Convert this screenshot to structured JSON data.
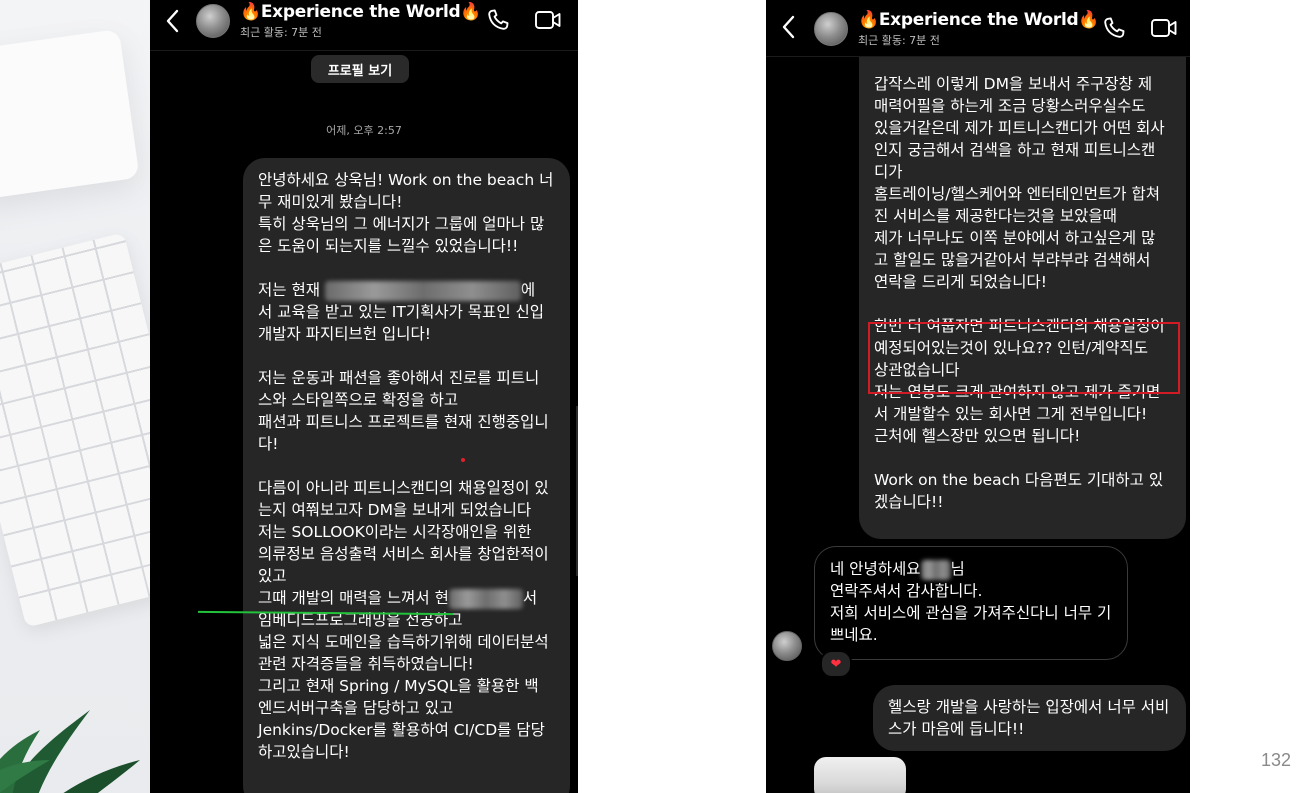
{
  "page": {
    "page_number": "132"
  },
  "left_chat": {
    "header": {
      "title": "🔥Experience the World🔥",
      "subtitle": "최근 활동: 7분 전"
    },
    "profile_button_label": "프로필 보기",
    "timestamp": "어제, 오후 2:57",
    "message": {
      "lines": [
        "안녕하세요 상욱님! Work on the beach 너",
        "무 재미있게 봤습니다!",
        "특히 상욱님의 그 에너지가 그룹에 얼마나 많",
        "은 도움이 되는지를 느낄수 있었습니다!!",
        "",
        "저는 현재",
        "에",
        "서 교육을 받고 있는 IT기획사가 목표인 신입",
        "개발자 파지티브헌 입니다!",
        "",
        "저는 운동과 패션을 좋아해서 진로를 피트니",
        "스와 스타일쪽으로 확정을 하고",
        "패션과 피트니스 프로젝트를 현재 진행중입니",
        "다!",
        "",
        "다름이 아니라 피트니스캔디의 채용일정이 있",
        "는지 여쭤보고자 DM을 보내게 되었습니다",
        "저는 SOLLOOK이라는 시각장애인을 위한",
        "의류정보 음성출력 서비스 회사를 창업한적이",
        "있고",
        "그때 개발의 매력을 느껴서 현",
        "서",
        "임베디드프로그래밍을 전공하고",
        "넓은 지식 도메인을 습득하기위해 데이터분석",
        "관련 자격증들을 취득하였습니다!",
        "그리고 현재 Spring /  MySQL을 활용한 백",
        "엔드서버구축을 담당하고 있고",
        "Jenkins/Docker를 활용하여 CI/CD를 담당",
        "하고있습니다!"
      ]
    }
  },
  "right_chat": {
    "header": {
      "title": "🔥Experience the World🔥",
      "subtitle": "최근 활동: 7분 전"
    },
    "outgoing_1": {
      "lines": [
        "갑작스레 이렇게 DM을 보내서 주구장창 제",
        "매력어필을 하는게 조금 당황스러우실수도",
        "있을거같은데 제가 피트니스캔디가 어떤 회사",
        "인지 궁금해서 검색을 하고 현재 피트니스캔",
        "디가",
        "홈트레이닝/헬스케어와 엔터테인먼트가 합쳐",
        "진 서비스를 제공한다는것을 보았을때",
        "제가 너무나도 이쪽 분야에서 하고싶은게 많",
        "고 할일도 많을거같아서 부랴부랴 검색해서",
        "연락을 드리게 되었습니다!",
        "",
        "한번 더 여쭙자면 피트니스캔디의 채용일정이",
        "예정되어있는것이 있나요?? 인턴/계약직도",
        "상관없습니다",
        "저는 연봉도 크게 관여하지 않고 제가 즐기면",
        "서 개발할수 있는 회사면 그게 전부입니다!",
        "근처에 헬스장만 있으면 됩니다!",
        "",
        "Work on the beach 다음편도 기대하고 있",
        "겠습니다!!"
      ]
    },
    "incoming": {
      "lines": [
        "네 안녕하세요",
        "님",
        "연락주셔서 감사합니다.",
        "저희 서비스에 관심을 가져주신다니 너무 기",
        "쁘네요."
      ],
      "reaction": "❤"
    },
    "outgoing_2": {
      "lines": [
        "헬스랑 개발을 사랑하는 입장에서 너무 서비",
        "스가 마음에 듭니다!!"
      ]
    }
  },
  "colors": {
    "chat_bg": "#000000",
    "bubble_bg": "#262626",
    "highlight": "#d21b24",
    "annotation_line": "#22c23a"
  }
}
